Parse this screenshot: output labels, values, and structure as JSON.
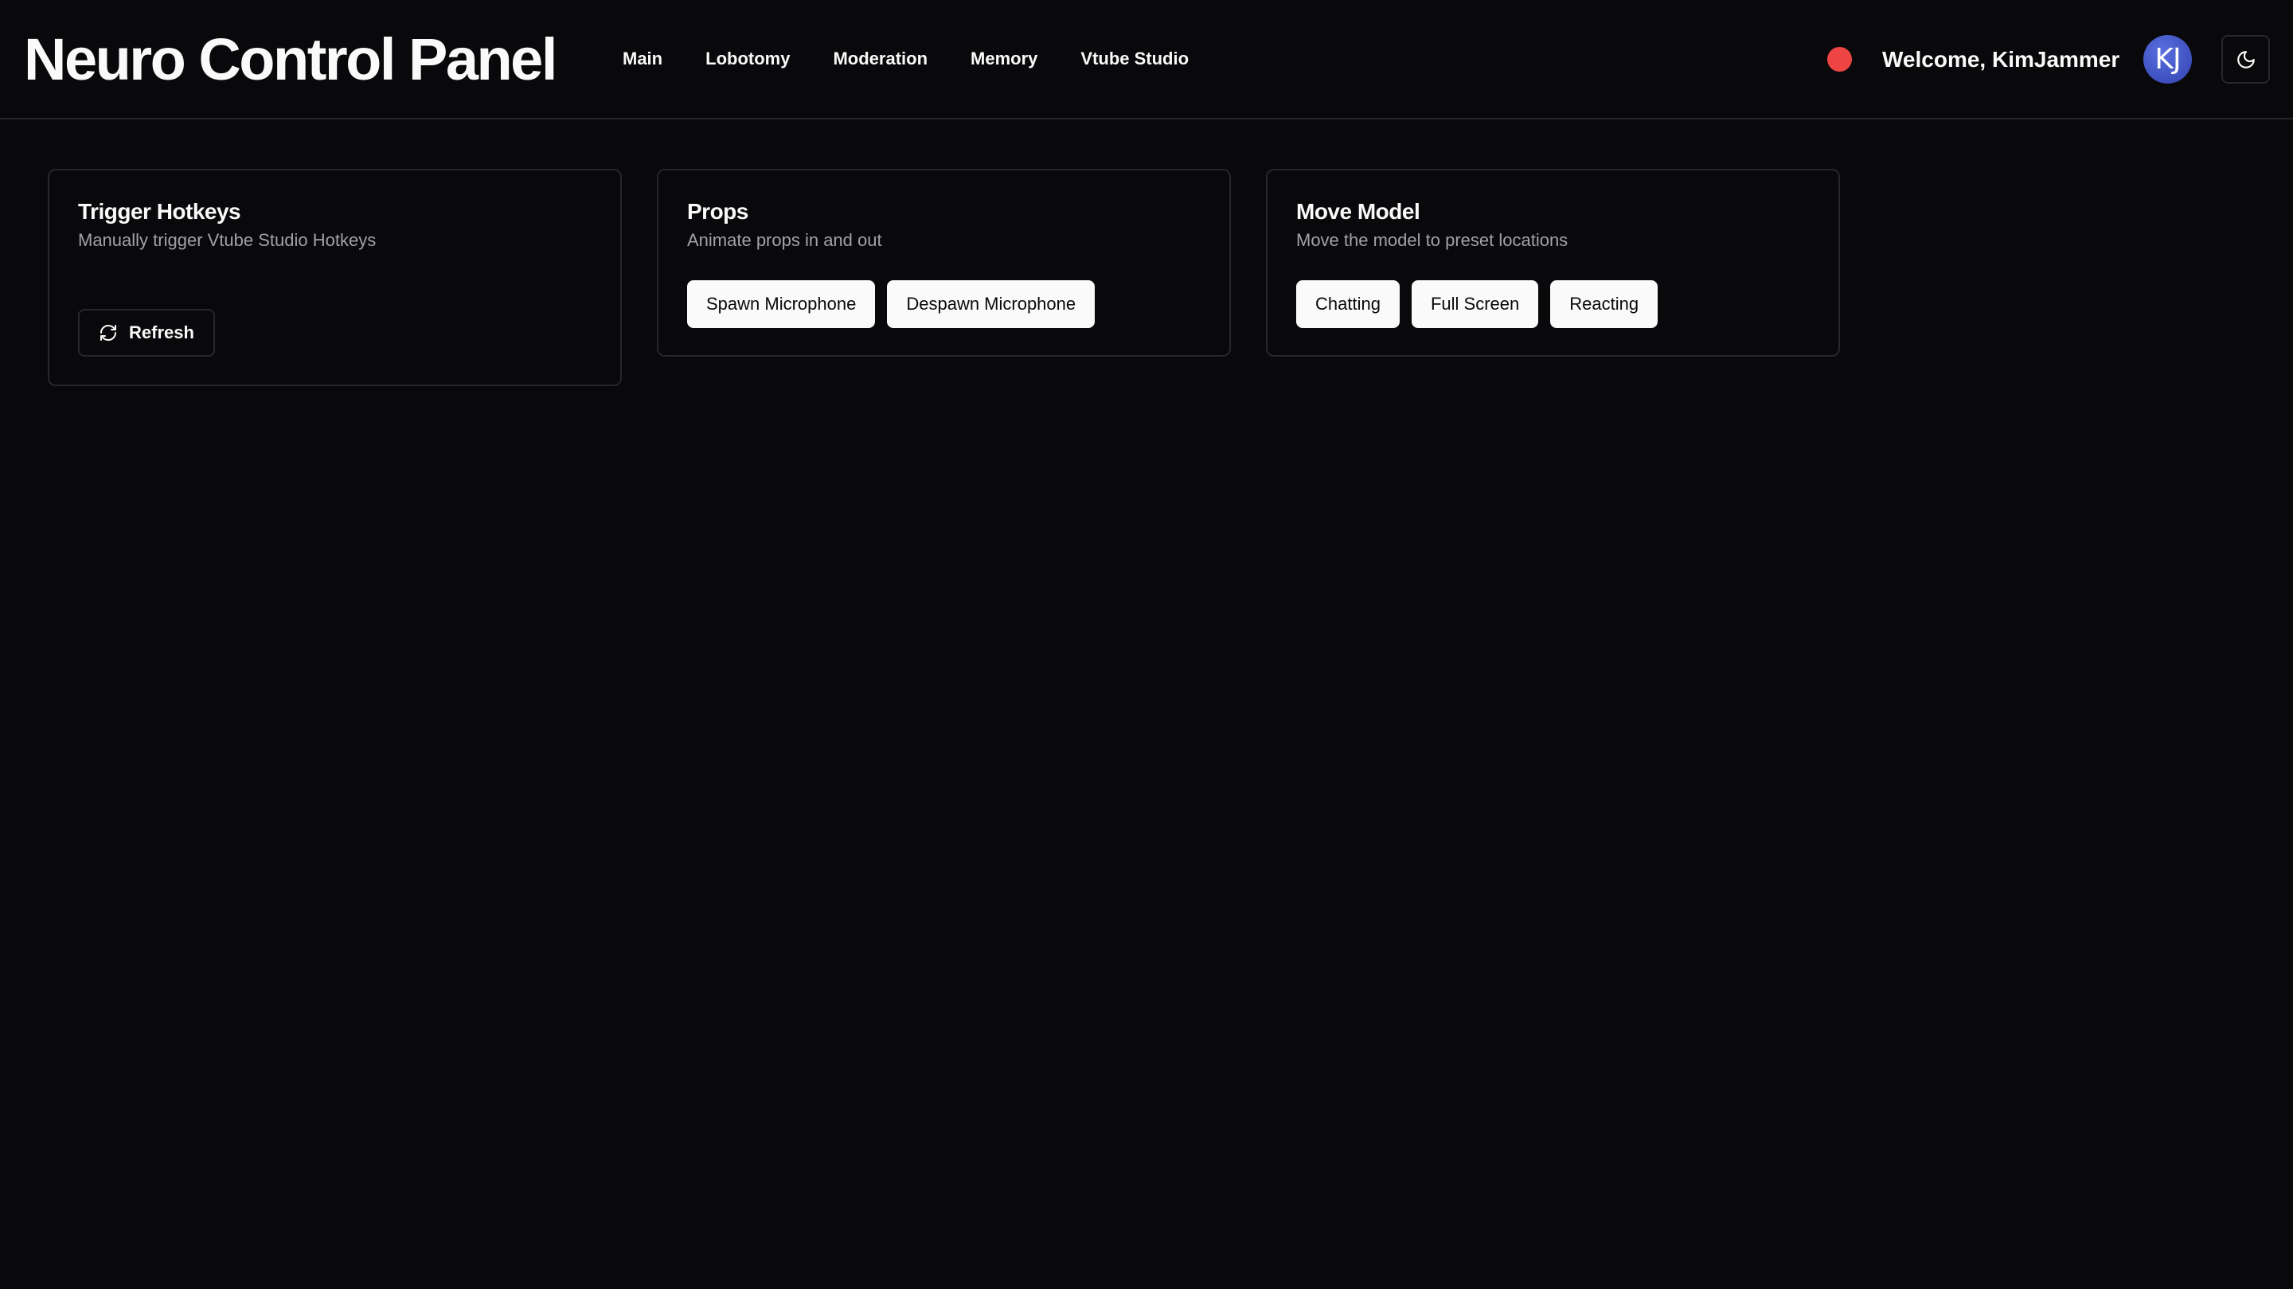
{
  "header": {
    "title": "Neuro Control Panel",
    "nav": [
      "Main",
      "Lobotomy",
      "Moderation",
      "Memory",
      "Vtube Studio"
    ],
    "status_color": "#ef4444",
    "welcome": "Welcome, KimJammer",
    "avatar_initials": "KJ",
    "theme_icon": "moon-icon"
  },
  "cards": {
    "hotkeys": {
      "title": "Trigger Hotkeys",
      "description": "Manually trigger Vtube Studio Hotkeys",
      "refresh_label": "Refresh",
      "refresh_icon": "refresh-icon"
    },
    "props": {
      "title": "Props",
      "description": "Animate props in and out",
      "buttons": [
        "Spawn Microphone",
        "Despawn Microphone"
      ]
    },
    "move_model": {
      "title": "Move Model",
      "description": "Move the model to preset locations",
      "buttons": [
        "Chatting",
        "Full Screen",
        "Reacting"
      ]
    }
  },
  "colors": {
    "background": "#09090b",
    "border": "#27272a",
    "text": "#fafafa",
    "muted_text": "#a1a1aa",
    "avatar": "#4155c8"
  }
}
